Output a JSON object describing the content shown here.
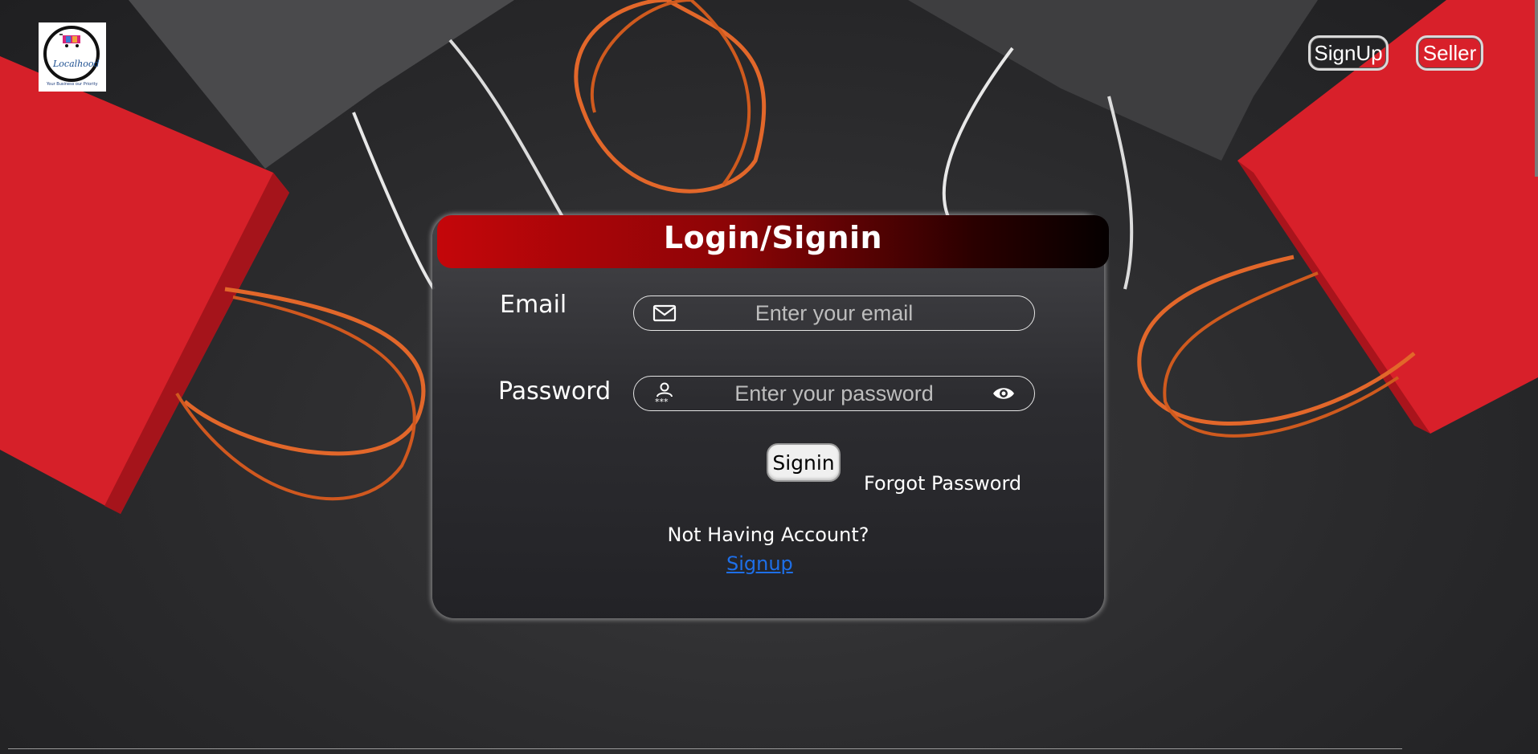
{
  "header": {
    "logo_text": "Localhood",
    "logo_tagline": "Your Business our Priority",
    "signup_label": "SignUp",
    "seller_label": "Seller"
  },
  "login_card": {
    "title": "Login/Signin",
    "email_label": "Email",
    "email_placeholder": "Enter your email",
    "password_label": "Password",
    "password_placeholder": "Enter your password",
    "signin_label": "Signin",
    "forgot_label": "Forgot Password",
    "no_account_text": "Not Having Account?",
    "signup_link_label": "Signup"
  },
  "icons": {
    "email_field_icon": "mail-icon",
    "password_field_icon": "user-key-icon",
    "password_toggle_icon": "eye-icon"
  },
  "colors": {
    "header_gradient_start": "#c4060a",
    "header_gradient_end": "#050000",
    "link": "#1e6fe8",
    "card_background": "#2c2c30"
  }
}
